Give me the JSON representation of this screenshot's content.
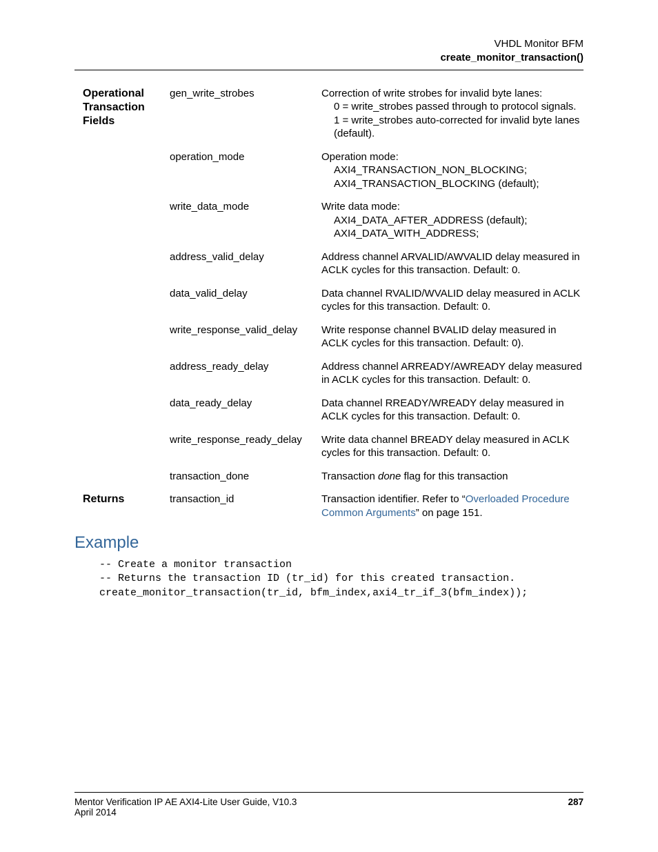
{
  "header": {
    "line1": "VHDL Monitor BFM",
    "line2": "create_monitor_transaction()"
  },
  "sections": {
    "op_fields_label": "Operational Transaction Fields",
    "returns_label": "Returns"
  },
  "rows": [
    {
      "field": "gen_write_strobes",
      "desc_lines": [
        "Correction of write strobes for invalid byte lanes:"
      ],
      "indent_lines": [
        "0 = write_strobes passed through to protocol signals.",
        "1 = write_strobes auto-corrected for invalid byte lanes (default)."
      ]
    },
    {
      "field": "operation_mode",
      "desc_lines": [
        "Operation mode:"
      ],
      "indent_lines": [
        "AXI4_TRANSACTION_NON_BLOCKING;",
        "AXI4_TRANSACTION_BLOCKING (default);"
      ]
    },
    {
      "field": "write_data_mode",
      "desc_lines": [
        "Write data mode:"
      ],
      "indent_lines": [
        "AXI4_DATA_AFTER_ADDRESS (default);",
        "AXI4_DATA_WITH_ADDRESS;"
      ]
    },
    {
      "field": "address_valid_delay",
      "desc_lines": [
        "Address channel ARVALID/AWVALID delay measured in ACLK cycles for this transaction. Default: 0."
      ],
      "indent_lines": []
    },
    {
      "field": "data_valid_delay",
      "desc_lines": [
        "Data channel RVALID/WVALID delay measured in ACLK cycles for this transaction. Default: 0."
      ],
      "indent_lines": []
    },
    {
      "field": "write_response_valid_delay",
      "desc_lines": [
        "Write response channel BVALID delay measured in ACLK cycles for this transaction. Default: 0)."
      ],
      "indent_lines": []
    },
    {
      "field": "address_ready_delay",
      "desc_lines": [
        "Address channel ARREADY/AWREADY delay measured in ACLK cycles for this transaction. Default: 0."
      ],
      "indent_lines": []
    },
    {
      "field": "data_ready_delay",
      "desc_lines": [
        "Data channel RREADY/WREADY delay measured in ACLK cycles for this transaction. Default: 0."
      ],
      "indent_lines": []
    },
    {
      "field": "write_response_ready_delay",
      "desc_lines": [
        "Write data channel BREADY delay measured in ACLK cycles for this transaction. Default: 0."
      ],
      "indent_lines": []
    },
    {
      "field": "transaction_done",
      "desc_html": "Transaction <span class=\"italic\">done</span> flag for this transaction"
    }
  ],
  "returns_row": {
    "field": "transaction_id",
    "desc_prefix": "Transaction identifier. Refer to “",
    "link_text": "Overloaded Procedure Common Arguments",
    "desc_suffix": "” on page 151."
  },
  "example": {
    "heading": "Example",
    "code": "-- Create a monitor transaction\n-- Returns the transaction ID (tr_id) for this created transaction.\ncreate_monitor_transaction(tr_id, bfm_index,axi4_tr_if_3(bfm_index));"
  },
  "footer": {
    "left": "Mentor Verification IP AE AXI4-Lite User Guide, V10.3",
    "right": "287",
    "date": "April 2014"
  }
}
